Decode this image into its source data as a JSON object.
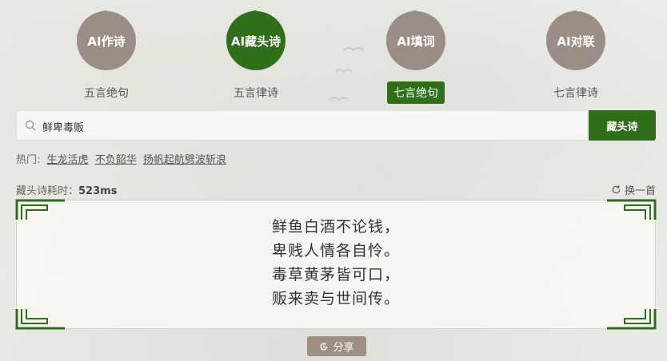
{
  "tabs": [
    {
      "title": "AI作诗",
      "subtitle": "五言绝句",
      "circle_color": "#9b8e86",
      "active_circle": false,
      "active_sub": false
    },
    {
      "title": "AI藏头诗",
      "subtitle": "五言律诗",
      "circle_color": "#2f6f1a",
      "active_circle": true,
      "active_sub": false
    },
    {
      "title": "AI填词",
      "subtitle": "七言绝句",
      "circle_color": "#9b8e86",
      "active_circle": false,
      "active_sub": true
    },
    {
      "title": "AI对联",
      "subtitle": "七言律诗",
      "circle_color": "#9b8e86",
      "active_circle": false,
      "active_sub": false
    }
  ],
  "search": {
    "value": "鲜卑毒贩",
    "icon": "search-icon"
  },
  "submit_label": "藏头诗",
  "hot": {
    "label": "热门:",
    "items": [
      "生龙活虎",
      "不负韶华",
      "扬帆起航劈波斩浪"
    ]
  },
  "timing": {
    "label": "藏头诗耗时：",
    "value": "523ms"
  },
  "refresh_label": "换一首",
  "poem": [
    "鲜鱼白酒不论钱，",
    "卑贱人情各自怜。",
    "毒草黄茅皆可口，",
    "贩来卖与世间传。"
  ],
  "share_label": "分享",
  "colors": {
    "accent": "#2f6f1a",
    "muted": "#9b8e86",
    "share": "#a08f84"
  }
}
